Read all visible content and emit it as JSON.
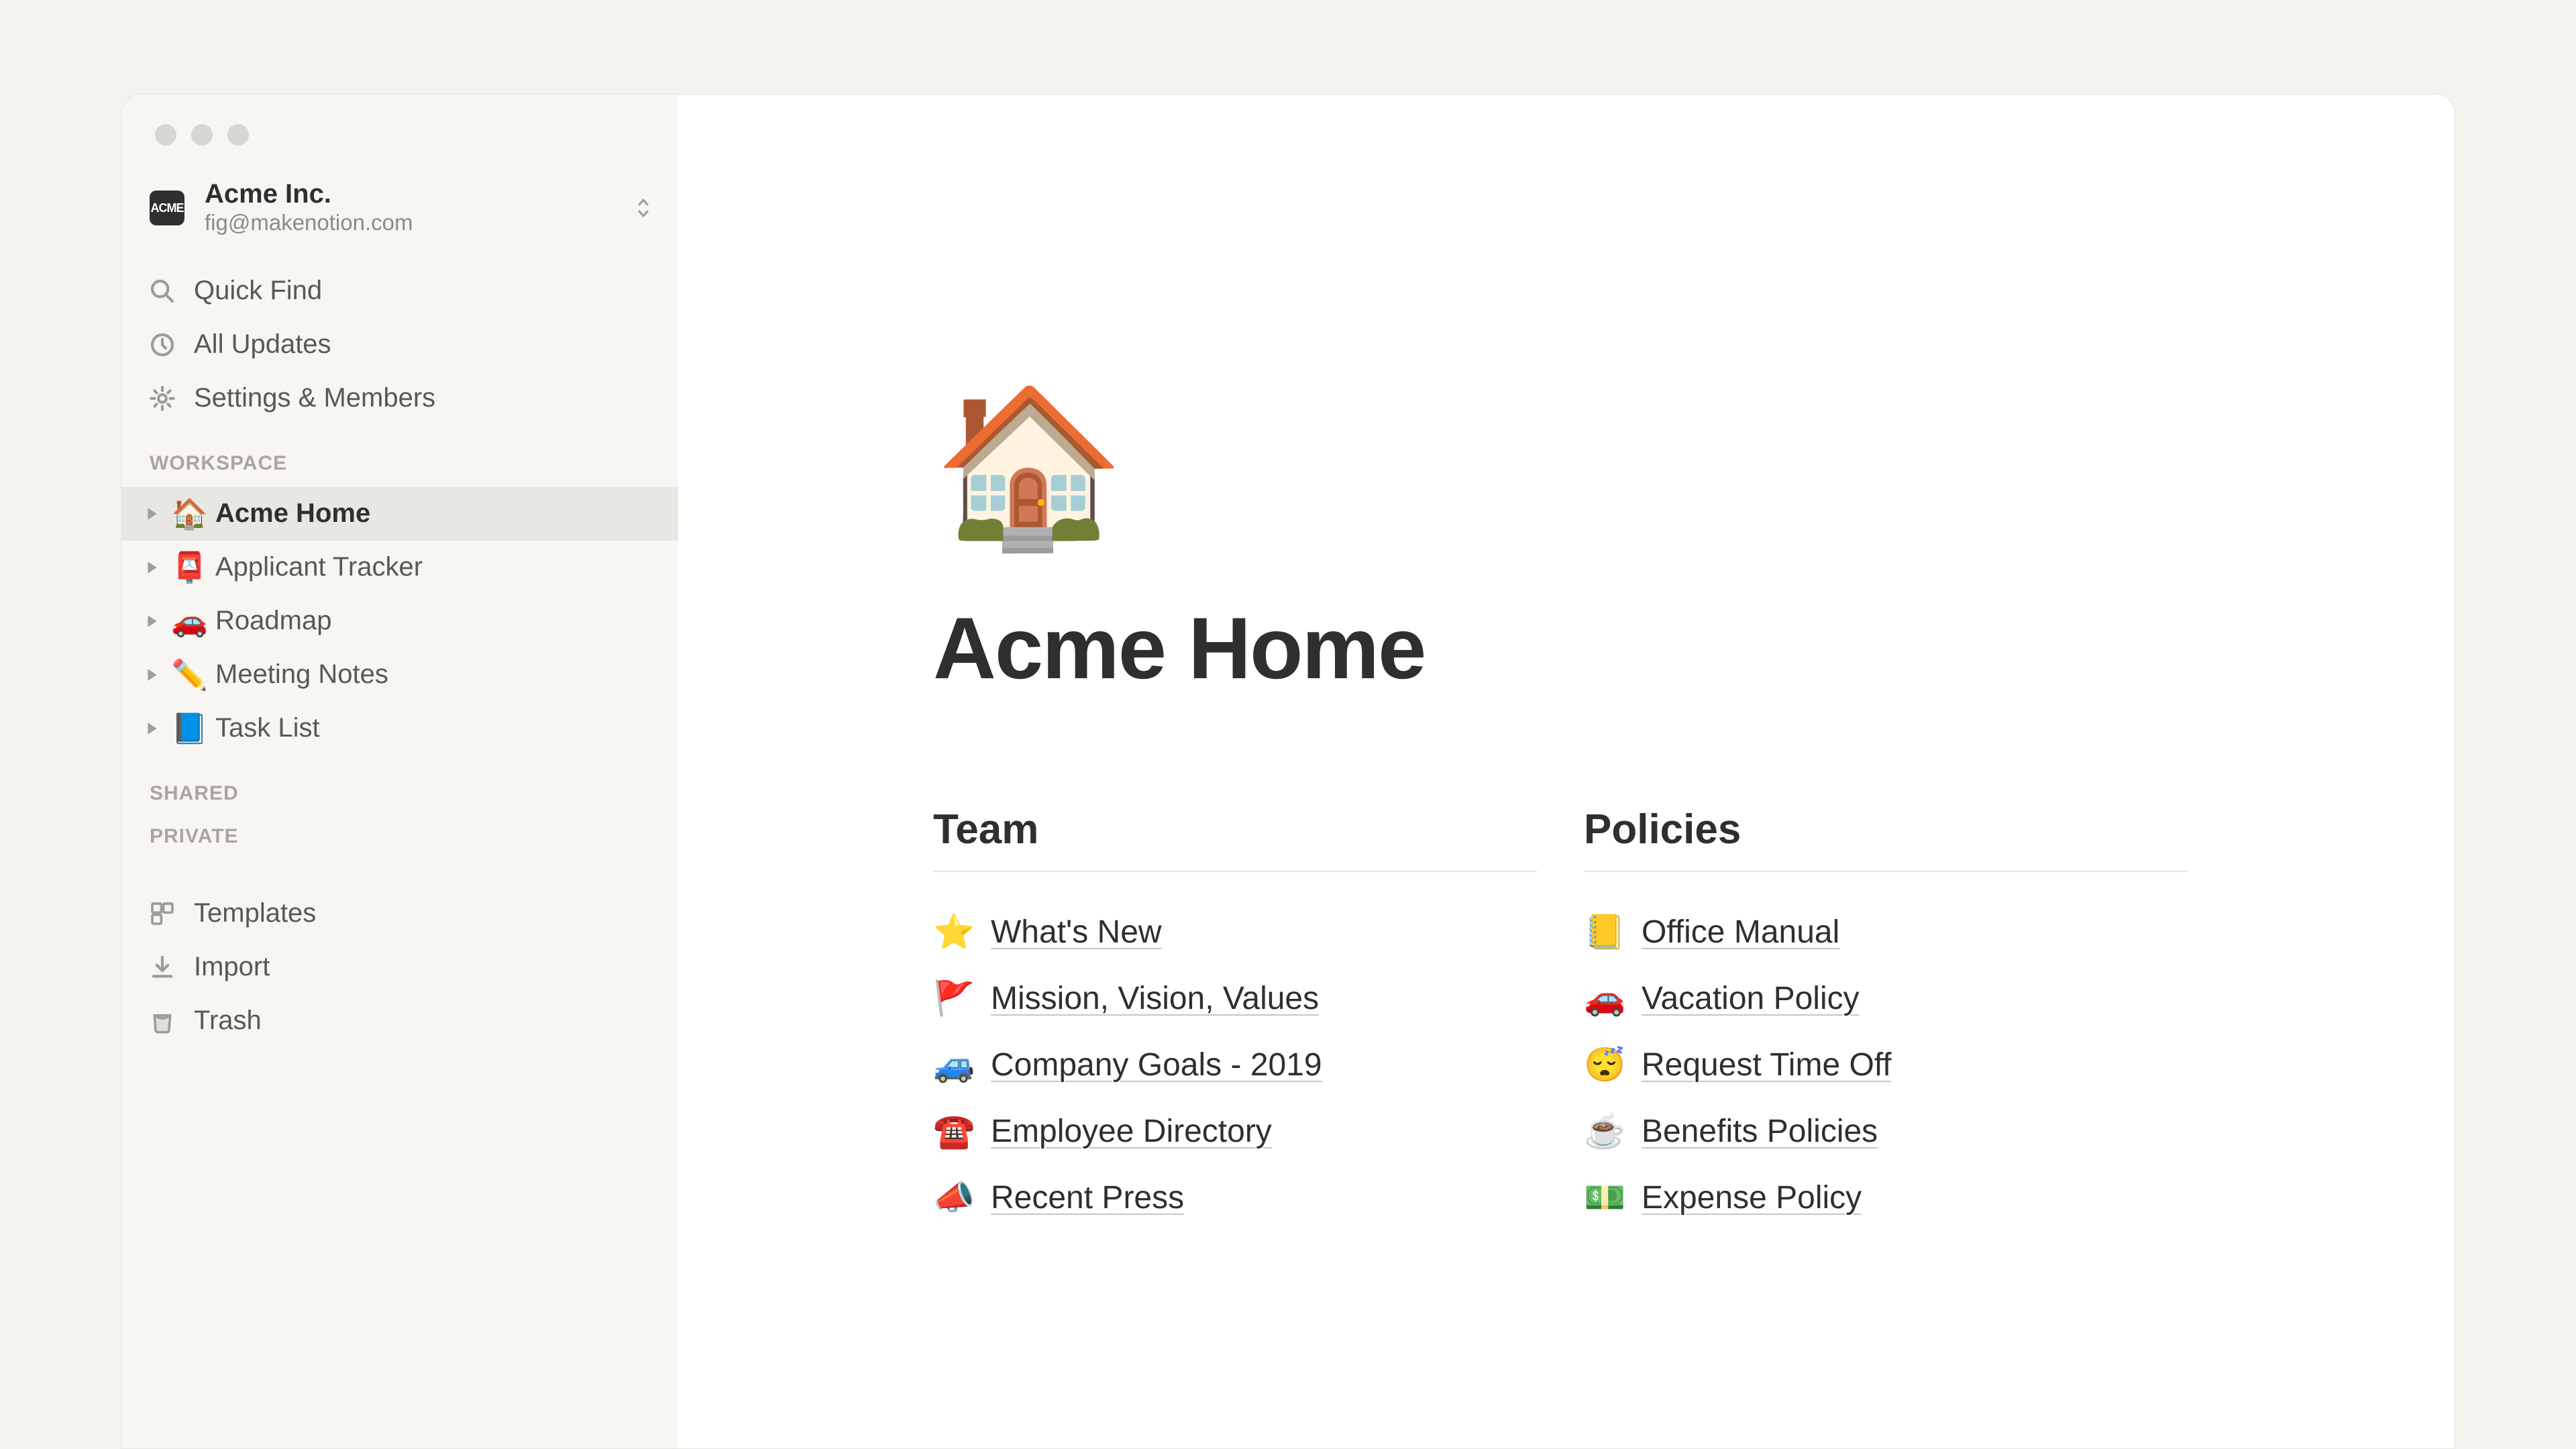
{
  "workspace": {
    "logo_text": "ACME",
    "name": "Acme Inc.",
    "email": "fig@makenotion.com"
  },
  "nav": {
    "quick_find": "Quick Find",
    "all_updates": "All Updates",
    "settings": "Settings & Members"
  },
  "sections": {
    "workspace": "WORKSPACE",
    "shared": "SHARED",
    "private": "PRIVATE"
  },
  "pages": [
    {
      "emoji": "🏠",
      "label": "Acme Home",
      "active": true
    },
    {
      "emoji": "📮",
      "label": "Applicant Tracker",
      "active": false
    },
    {
      "emoji": "🚗",
      "label": "Roadmap",
      "active": false
    },
    {
      "emoji": "✏️",
      "label": "Meeting Notes",
      "active": false
    },
    {
      "emoji": "📘",
      "label": "Task List",
      "active": false
    }
  ],
  "bottom_nav": {
    "templates": "Templates",
    "import": "Import",
    "trash": "Trash"
  },
  "page": {
    "icon": "🏠",
    "title": "Acme Home",
    "columns": [
      {
        "heading": "Team",
        "links": [
          {
            "emoji": "⭐",
            "label": "What's New"
          },
          {
            "emoji": "🚩",
            "label": "Mission, Vision, Values"
          },
          {
            "emoji": "🚙",
            "label": "Company Goals - 2019"
          },
          {
            "emoji": "☎️",
            "label": "Employee Directory"
          },
          {
            "emoji": "📣",
            "label": "Recent Press"
          }
        ]
      },
      {
        "heading": "Policies",
        "links": [
          {
            "emoji": "📒",
            "label": "Office Manual"
          },
          {
            "emoji": "🚗",
            "label": "Vacation Policy"
          },
          {
            "emoji": "😴",
            "label": "Request Time Off"
          },
          {
            "emoji": "☕",
            "label": "Benefits Policies"
          },
          {
            "emoji": "💵",
            "label": "Expense Policy"
          }
        ]
      }
    ]
  }
}
